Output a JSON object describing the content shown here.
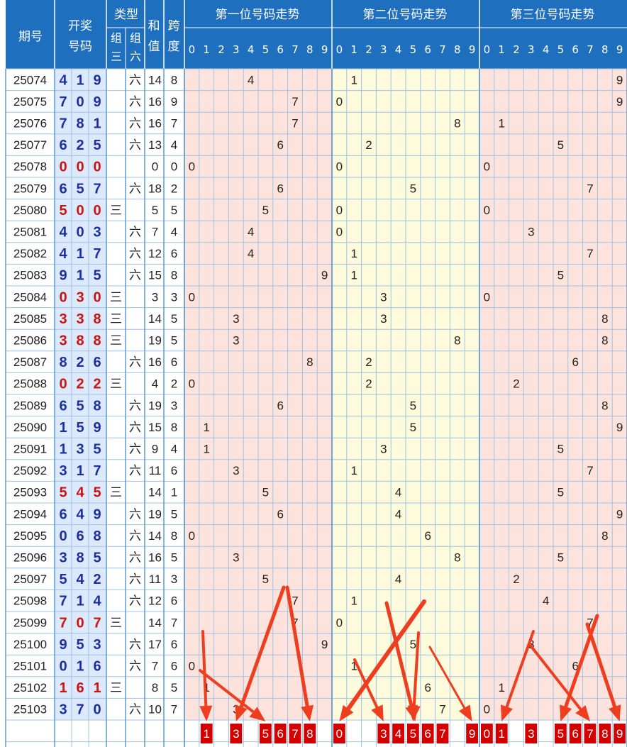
{
  "header": {
    "issue_label": "期号",
    "draw_label_1": "开奖",
    "draw_label_2": "号码",
    "type_label": "类型",
    "type_sub_1a": "组",
    "type_sub_1b": "三",
    "type_sub_2a": "组",
    "type_sub_2b": "六",
    "sum_label_1": "和",
    "sum_label_2": "值",
    "span_label_1": "跨",
    "span_label_2": "度",
    "pos1_label": "第一位号码走势",
    "pos2_label": "第二位号码走势",
    "pos3_label": "第三位号码走势",
    "digits": [
      "0",
      "1",
      "2",
      "3",
      "4",
      "5",
      "6",
      "7",
      "8",
      "9"
    ]
  },
  "colors": {
    "header_bg": "#1f6fbf",
    "left_bg": "#dbe9fb",
    "pos1_bg": "#fde3dc",
    "pos2_bg": "#fdfbdc",
    "pos3_bg": "#fde3dc",
    "group6_digit": "#1b2f9e",
    "group3_digit": "#cc1111",
    "box_fill": "#d40000",
    "arrow": "#ef3d1f"
  },
  "chart_data": {
    "type": "table",
    "columns": [
      "期号",
      "开奖号码",
      "组三",
      "组六",
      "和值",
      "跨度",
      "第一位号码走势",
      "第二位号码走势",
      "第三位号码走势"
    ],
    "rows": [
      {
        "issue": "25074",
        "digits": [
          4,
          1,
          9
        ],
        "type": "六",
        "sum": 14,
        "span": 8
      },
      {
        "issue": "25075",
        "digits": [
          7,
          0,
          9
        ],
        "type": "六",
        "sum": 16,
        "span": 9
      },
      {
        "issue": "25076",
        "digits": [
          7,
          8,
          1
        ],
        "type": "六",
        "sum": 16,
        "span": 7
      },
      {
        "issue": "25077",
        "digits": [
          6,
          2,
          5
        ],
        "type": "六",
        "sum": 13,
        "span": 4
      },
      {
        "issue": "25078",
        "digits": [
          0,
          0,
          0
        ],
        "type": "",
        "sum": 0,
        "span": 0
      },
      {
        "issue": "25079",
        "digits": [
          6,
          5,
          7
        ],
        "type": "六",
        "sum": 18,
        "span": 2
      },
      {
        "issue": "25080",
        "digits": [
          5,
          0,
          0
        ],
        "type": "三",
        "sum": 5,
        "span": 5
      },
      {
        "issue": "25081",
        "digits": [
          4,
          0,
          3
        ],
        "type": "六",
        "sum": 7,
        "span": 4
      },
      {
        "issue": "25082",
        "digits": [
          4,
          1,
          7
        ],
        "type": "六",
        "sum": 12,
        "span": 6
      },
      {
        "issue": "25083",
        "digits": [
          9,
          1,
          5
        ],
        "type": "六",
        "sum": 15,
        "span": 8
      },
      {
        "issue": "25084",
        "digits": [
          0,
          3,
          0
        ],
        "type": "三",
        "sum": 3,
        "span": 3
      },
      {
        "issue": "25085",
        "digits": [
          3,
          3,
          8
        ],
        "type": "三",
        "sum": 14,
        "span": 5
      },
      {
        "issue": "25086",
        "digits": [
          3,
          8,
          8
        ],
        "type": "三",
        "sum": 19,
        "span": 5
      },
      {
        "issue": "25087",
        "digits": [
          8,
          2,
          6
        ],
        "type": "六",
        "sum": 16,
        "span": 6
      },
      {
        "issue": "25088",
        "digits": [
          0,
          2,
          2
        ],
        "type": "三",
        "sum": 4,
        "span": 2
      },
      {
        "issue": "25089",
        "digits": [
          6,
          5,
          8
        ],
        "type": "六",
        "sum": 19,
        "span": 3
      },
      {
        "issue": "25090",
        "digits": [
          1,
          5,
          9
        ],
        "type": "六",
        "sum": 15,
        "span": 8
      },
      {
        "issue": "25091",
        "digits": [
          1,
          3,
          5
        ],
        "type": "六",
        "sum": 9,
        "span": 4
      },
      {
        "issue": "25092",
        "digits": [
          3,
          1,
          7
        ],
        "type": "六",
        "sum": 11,
        "span": 6
      },
      {
        "issue": "25093",
        "digits": [
          5,
          4,
          5
        ],
        "type": "三",
        "sum": 14,
        "span": 1
      },
      {
        "issue": "25094",
        "digits": [
          6,
          4,
          9
        ],
        "type": "六",
        "sum": 19,
        "span": 5
      },
      {
        "issue": "25095",
        "digits": [
          0,
          6,
          8
        ],
        "type": "六",
        "sum": 14,
        "span": 8
      },
      {
        "issue": "25096",
        "digits": [
          3,
          8,
          5
        ],
        "type": "六",
        "sum": 16,
        "span": 5
      },
      {
        "issue": "25097",
        "digits": [
          5,
          4,
          2
        ],
        "type": "六",
        "sum": 11,
        "span": 3
      },
      {
        "issue": "25098",
        "digits": [
          7,
          1,
          4
        ],
        "type": "六",
        "sum": 12,
        "span": 6
      },
      {
        "issue": "25099",
        "digits": [
          7,
          0,
          7
        ],
        "type": "三",
        "sum": 14,
        "span": 7
      },
      {
        "issue": "25100",
        "digits": [
          9,
          5,
          3
        ],
        "type": "六",
        "sum": 17,
        "span": 6
      },
      {
        "issue": "25101",
        "digits": [
          0,
          1,
          6
        ],
        "type": "六",
        "sum": 7,
        "span": 6
      },
      {
        "issue": "25102",
        "digits": [
          1,
          6,
          1
        ],
        "type": "三",
        "sum": 8,
        "span": 5
      },
      {
        "issue": "25103",
        "digits": [
          3,
          7,
          0
        ],
        "type": "六",
        "sum": 10,
        "span": 7
      }
    ],
    "predictions": {
      "pos1": [
        1,
        3,
        5,
        6,
        7,
        8
      ],
      "pos2": [
        0,
        3,
        4,
        5,
        6,
        7,
        9
      ],
      "pos3": [
        0,
        1,
        3,
        5,
        6,
        7,
        8,
        9
      ]
    }
  }
}
